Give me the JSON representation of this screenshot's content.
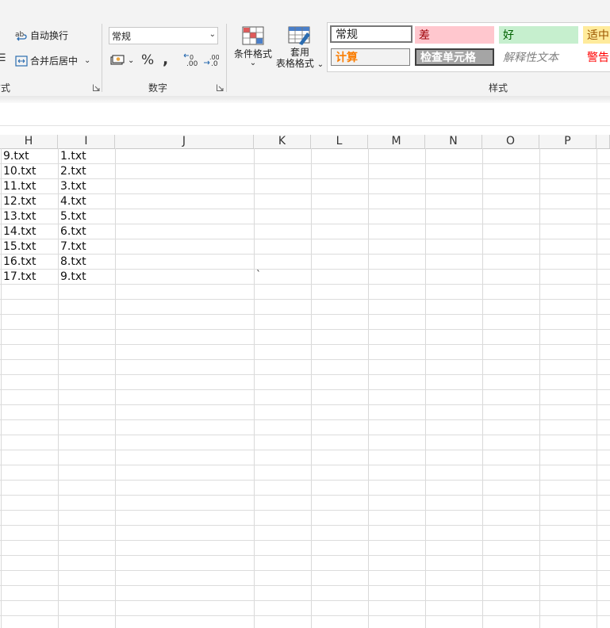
{
  "ribbon": {
    "alignment": {
      "wrap_text_label": "自动换行",
      "merge_center_label": "合并后居中",
      "group_label": "方式"
    },
    "number": {
      "format_value": "常规",
      "group_label": "数字"
    },
    "styles": {
      "conditional_format_label": "条件格式",
      "format_table_label_line1": "套用",
      "format_table_label_line2": "表格格式",
      "group_label": "样式",
      "gallery": [
        {
          "label": "常规",
          "bg": "#ffffff",
          "fg": "#222222"
        },
        {
          "label": "差",
          "bg": "#ffc7ce",
          "fg": "#9c0006"
        },
        {
          "label": "好",
          "bg": "#c6efce",
          "fg": "#006100"
        },
        {
          "label": "适中",
          "bg": "#ffeb9c",
          "fg": "#9c5700"
        },
        {
          "label": "计算",
          "bg": "#f2f2f2",
          "fg": "#fa7d00"
        },
        {
          "label": "检查单元格",
          "bg": "#a5a5a5",
          "fg": "#ffffff"
        },
        {
          "label": "解释性文本",
          "bg": "#ffffff",
          "fg": "#7f7f7f"
        },
        {
          "label": "警告",
          "bg": "#ffffff",
          "fg": "#ff0000"
        }
      ]
    }
  },
  "sheet": {
    "columns": [
      "H",
      "I",
      "J",
      "K",
      "L",
      "M",
      "N",
      "O",
      "P"
    ],
    "col_h_values": [
      "9.txt",
      "10.txt",
      "11.txt",
      "12.txt",
      "13.txt",
      "14.txt",
      "15.txt",
      "16.txt",
      "17.txt"
    ],
    "col_i_values": [
      "1.txt",
      "2.txt",
      "3.txt",
      "4.txt",
      "5.txt",
      "6.txt",
      "7.txt",
      "8.txt",
      "9.txt"
    ],
    "stray_mark": "`"
  }
}
